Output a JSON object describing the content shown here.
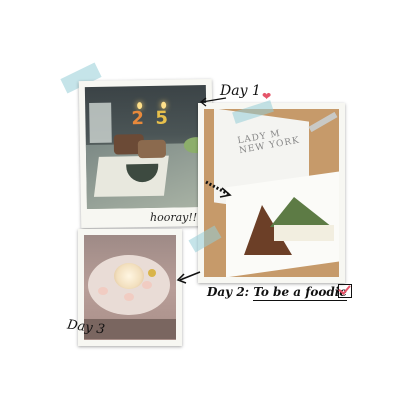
{
  "title": "",
  "labels": {
    "day1": "Day 1",
    "day2_prefix": "Day 2:",
    "day2_suffix": "To be a foodie",
    "day3": "Day 3",
    "hooray": "hooray!!"
  },
  "photo2": {
    "brand_line1": "LADY M",
    "brand_line2": "NEW YORK"
  },
  "candles": [
    "2",
    "5"
  ],
  "icons": {
    "heart": "heart-icon",
    "check": "checkbox-icon",
    "arrow": "arrow-icon"
  },
  "colors": {
    "tape": "#96cdd7",
    "heart": "#e5556a",
    "ink": "#111111"
  }
}
